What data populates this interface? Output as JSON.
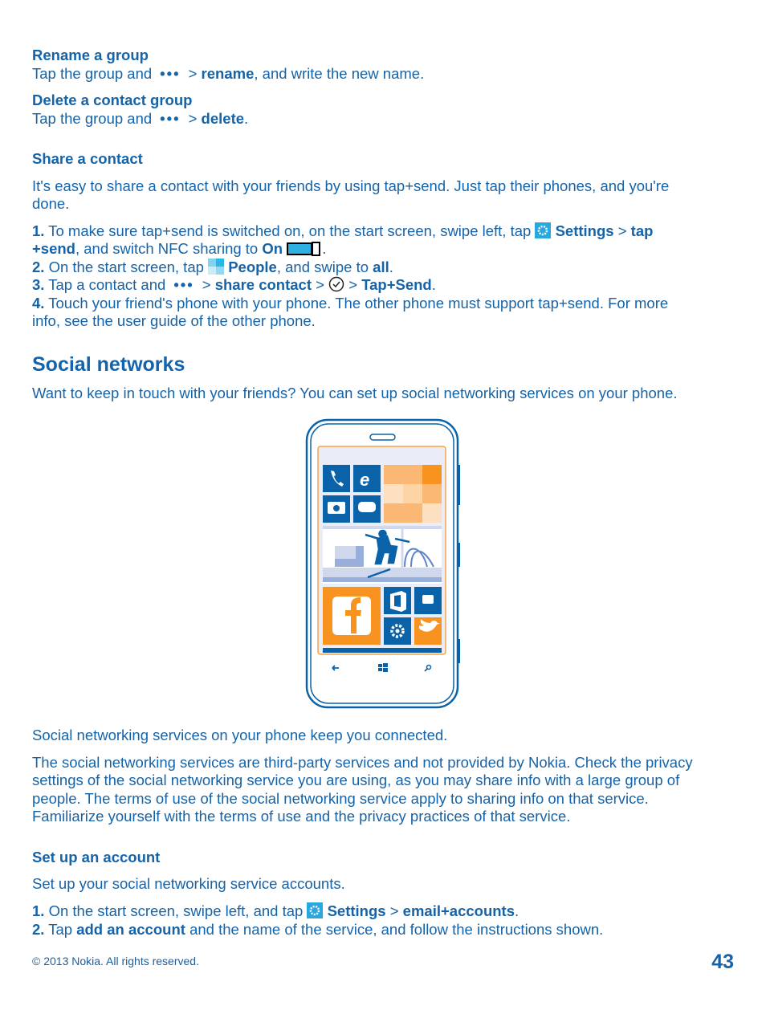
{
  "rename": {
    "title": "Rename a group",
    "pre": "Tap the group and",
    "more": "•••",
    "sep": ">",
    "action": "rename",
    "post": ", and write the new name."
  },
  "delete": {
    "title": "Delete a contact group",
    "pre": "Tap the group and",
    "more": "•••",
    "sep": ">",
    "action": "delete",
    "post": "."
  },
  "share": {
    "title": "Share a contact",
    "intro1": "It's easy to share a contact with your friends by using tap+send. Just tap their phones, and you're",
    "intro2": "done.",
    "s1n": "1.",
    "s1a": "To make sure tap+send is switched on, on the start screen, swipe left, tap",
    "s1b": "Settings",
    "s1c": ">",
    "s1d": "tap",
    "s1e": "+send",
    "s1f": ", and switch NFC sharing to",
    "s1g": "On",
    "s1h": ".",
    "s2n": "2.",
    "s2a": "On the start screen, tap",
    "s2b": "People",
    "s2c": ", and swipe to",
    "s2d": "all",
    "s2e": ".",
    "s3n": "3.",
    "s3a": "Tap a contact and",
    "s3more": "•••",
    "s3b": ">",
    "s3c": "share contact",
    "s3d": ">",
    "s3e": ">",
    "s3f": "Tap+Send",
    "s3g": ".",
    "s4n": "4.",
    "s4a": "Touch your friend's phone with your phone. The other phone must support tap+send. For more",
    "s4b": "info, see the user guide of the other phone."
  },
  "social": {
    "title": "Social networks",
    "intro": "Want to keep in touch with your friends? You can set up social networking services on your phone.",
    "caption": "Social networking services on your phone keep you connected.",
    "p1": "The social networking services are third-party services and not provided by Nokia. Check the privacy",
    "p2": "settings of the social networking service you are using, as you may share info with a large group of",
    "p3": "people. The terms of use of the social networking service apply to sharing info on that service.",
    "p4": "Familiarize yourself with the terms of use and the privacy practices of that service."
  },
  "account": {
    "title": "Set up an account",
    "intro": "Set up your social networking service accounts.",
    "s1n": "1.",
    "s1a": "On the start screen, swipe left, and tap",
    "s1b": "Settings",
    "s1c": ">",
    "s1d": "email+accounts",
    "s1e": ".",
    "s2n": "2.",
    "s2a": "Tap",
    "s2b": "add an account",
    "s2c": "and the name of the service, and follow the instructions shown."
  },
  "footer": {
    "copyright": "© 2013 Nokia. All rights reserved.",
    "page": "43"
  },
  "colors": {
    "text": "#1563a8",
    "tile_blue": "#0a63a9",
    "tile_orange": "#f7931e"
  }
}
